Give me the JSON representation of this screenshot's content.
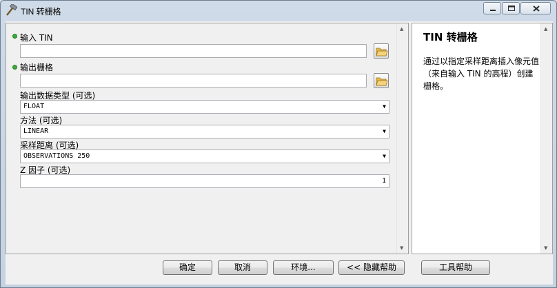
{
  "window": {
    "title": "TIN 转栅格"
  },
  "params": {
    "input_tin": {
      "label": "输入 TIN",
      "value": ""
    },
    "output_raster": {
      "label": "输出栅格",
      "value": ""
    },
    "data_type": {
      "label": "输出数据类型 (可选)",
      "value": "FLOAT"
    },
    "method": {
      "label": "方法 (可选)",
      "value": "LINEAR"
    },
    "sampling": {
      "label": "采样距离 (可选)",
      "value": "OBSERVATIONS 250"
    },
    "z_factor": {
      "label": "Z 因子 (可选)",
      "value": "1"
    }
  },
  "help": {
    "title": "TIN 转栅格",
    "body": "通过以指定采样距离插入像元值（来自输入 TIN 的高程）创建栅格。"
  },
  "buttons": {
    "ok": "确定",
    "cancel": "取消",
    "environments": "环境...",
    "hide_help": "<< 隐藏帮助",
    "tool_help": "工具帮助"
  },
  "colors": {
    "required_dot": "#3caa3c",
    "accent": "#c4d2e2"
  }
}
